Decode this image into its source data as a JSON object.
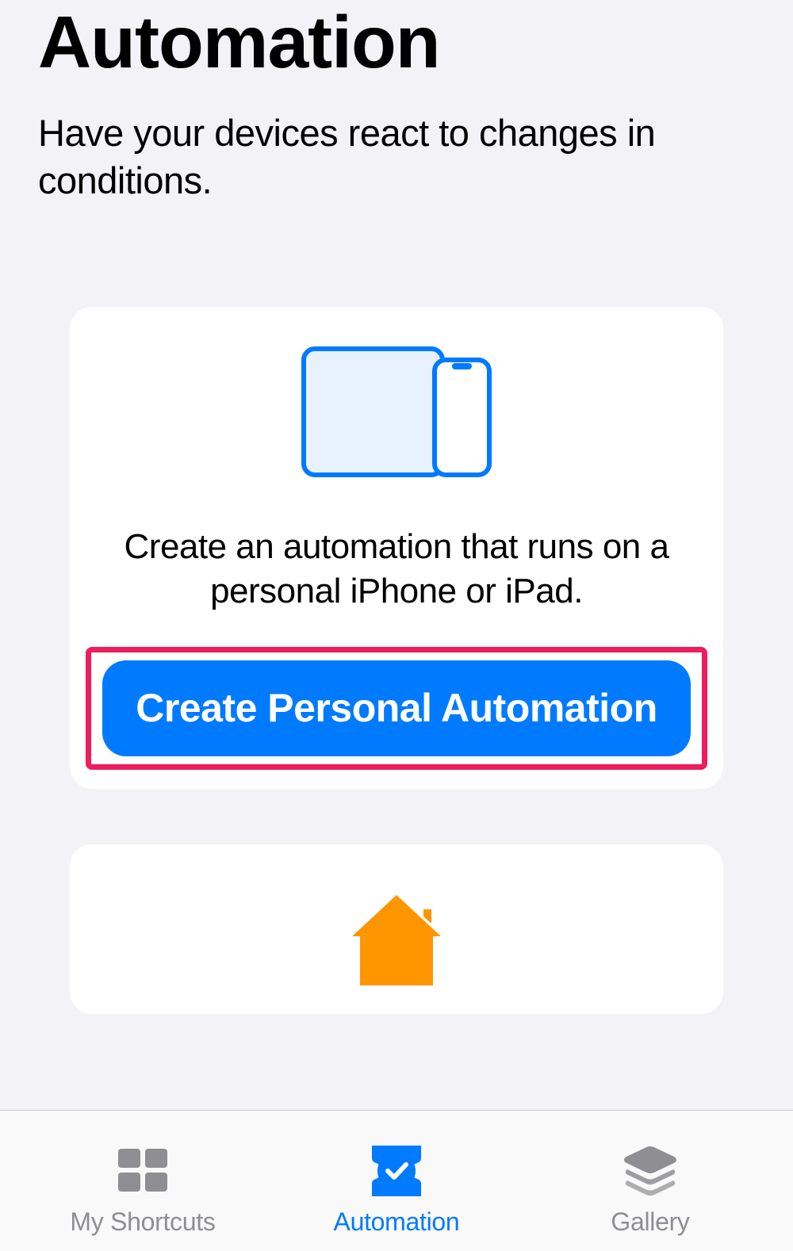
{
  "header": {
    "title": "Automation",
    "subtitle": "Have your devices react to changes in conditions."
  },
  "personal_card": {
    "description": "Create an automation that runs on a personal iPhone or iPad.",
    "button_label": "Create Personal Automation"
  },
  "home_card": {
    "icon": "house-icon"
  },
  "tabbar": {
    "items": [
      {
        "label": "My Shortcuts",
        "icon": "grid-icon",
        "active": false
      },
      {
        "label": "Automation",
        "icon": "checkmark-badge-icon",
        "active": true
      },
      {
        "label": "Gallery",
        "icon": "layers-icon",
        "active": false
      }
    ]
  },
  "colors": {
    "accent": "#007aff",
    "highlight": "#ee1d5d",
    "home_orange": "#ff9500"
  }
}
